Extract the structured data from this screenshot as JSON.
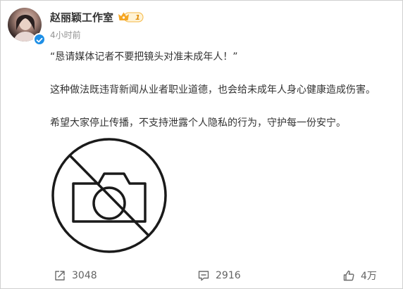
{
  "post": {
    "author": "赵丽颖工作室",
    "badge": "1",
    "time": "4小时前",
    "paragraphs": [
      "“恳请媒体记者不要把镜头对准未成年人！”",
      "这种做法既违背新闻从业者职业道德，也会给未成年人身心健康造成伤害。",
      "希望大家停止传播，不支持泄露个人隐私的行为，守护每一份安宁。"
    ],
    "image_icon": "no-camera-icon"
  },
  "actions": {
    "share_count": "3048",
    "comment_count": "2916",
    "like_count": "4万"
  },
  "colors": {
    "verified": "#1e8fe6",
    "badge_gold": "#f5a623",
    "muted_text": "#939393"
  }
}
